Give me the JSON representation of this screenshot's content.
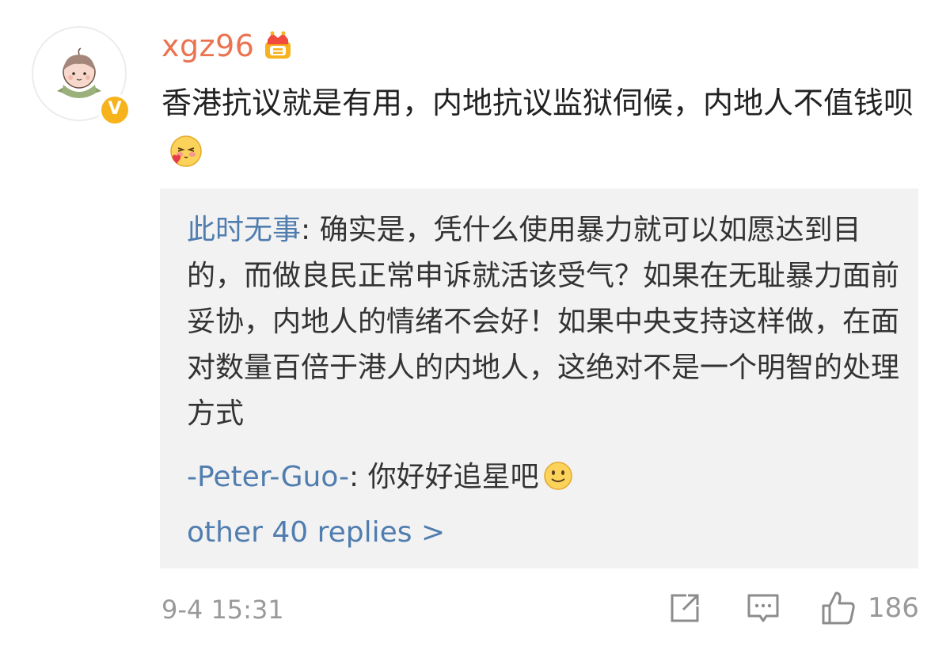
{
  "comment": {
    "username": "xgz96",
    "avatar_icon": "peach-avatar-icon",
    "badge_icon": "verified-v-icon",
    "badge_text": "V",
    "badge_color": "#f6b31c",
    "vip_icon": "crown-icon",
    "text": "香港抗议就是有用，内地抗议监狱伺候，内地人不值钱呗",
    "emoji": "shy-love-emoji",
    "timestamp": "9-4 15:31",
    "like_count": "186",
    "username_color": "#eb7350",
    "link_color": "#507daf"
  },
  "replies": [
    {
      "author": "此时无事",
      "separator": ": ",
      "text": "确实是，凭什么使用暴力就可以如愿达到目的，而做良民正常申诉就活该受气？如果在无耻暴力面前妥协，内地人的情绪不会好！如果中央支持这样做，在面对数量百倍于港人的内地人，这绝对不是一个明智的处理方式"
    },
    {
      "author": "-Peter-Guo-",
      "separator": ": ",
      "text": "你好好追星吧",
      "emoji": "smile-emoji"
    }
  ],
  "more_replies": "other 40 replies >",
  "actions": {
    "repost_icon": "repost-icon",
    "comment_icon": "comment-icon",
    "like_icon": "thumbs-up-icon"
  }
}
